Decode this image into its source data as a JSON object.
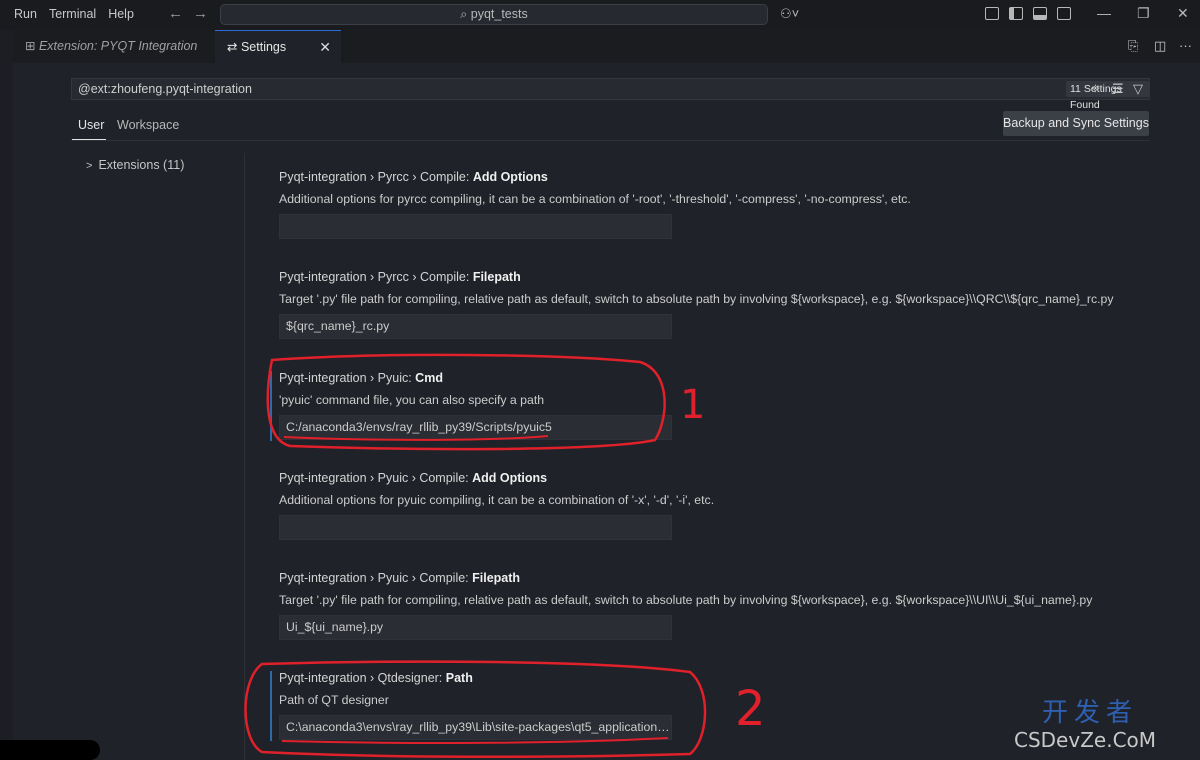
{
  "menu": [
    "Run",
    "Terminal",
    "Help"
  ],
  "command_center": {
    "text": "pyqt_tests"
  },
  "tabs": [
    {
      "label": "Extension: PYQT Integration"
    },
    {
      "label": "Settings",
      "close": "✕"
    }
  ],
  "search": {
    "value": "@ext:zhoufeng.pyqt-integration",
    "found": "11 Settings Found"
  },
  "scope": {
    "user": "User",
    "workspace": "Workspace"
  },
  "sync_button": "Backup and Sync Settings",
  "toc": {
    "item": "Extensions (11)"
  },
  "settings": [
    {
      "prefix": "Pyqt-integration › Pyrcc › Compile: ",
      "name": "Add Options",
      "description": "Additional options for pyrcc compiling, it can be a combination of '-root', '-threshold', '-compress', '-no-compress', etc.",
      "value": ""
    },
    {
      "prefix": "Pyqt-integration › Pyrcc › Compile: ",
      "name": "Filepath",
      "description": "Target '.py' file path for compiling, relative path as default, switch to absolute path by involving ${workspace}, e.g. ${workspace}\\\\QRC\\\\${qrc_name}_rc.py",
      "value": "${qrc_name}_rc.py"
    },
    {
      "prefix": "Pyqt-integration › Pyuic: ",
      "name": "Cmd",
      "description": "'pyuic' command file, you can also specify a path",
      "value": "C:/anaconda3/envs/ray_rllib_py39/Scripts/pyuic5"
    },
    {
      "prefix": "Pyqt-integration › Pyuic › Compile: ",
      "name": "Add Options",
      "description": "Additional options for pyuic compiling, it can be a combination of '-x', '-d', '-i', etc.",
      "value": ""
    },
    {
      "prefix": "Pyqt-integration › Pyuic › Compile: ",
      "name": "Filepath",
      "description": "Target '.py' file path for compiling, relative path as default, switch to absolute path by involving ${workspace}, e.g. ${workspace}\\\\UI\\\\Ui_${ui_name}.py",
      "value": "Ui_${ui_name}.py"
    },
    {
      "prefix": "Pyqt-integration › Qtdesigner: ",
      "name": "Path",
      "description": "Path of QT designer",
      "value": "C:\\anaconda3\\envs\\ray_rllib_py39\\Lib\\site-packages\\qt5_applications..."
    }
  ],
  "annotations": {
    "mark1": "1",
    "mark2": "2"
  },
  "watermark": {
    "cn": "开发者",
    "text": "CSDevZe.CoM"
  },
  "colors": {
    "annotation": "#e0202a",
    "accent": "#2b6bd6",
    "modified_bar": "#2d6aa6"
  }
}
